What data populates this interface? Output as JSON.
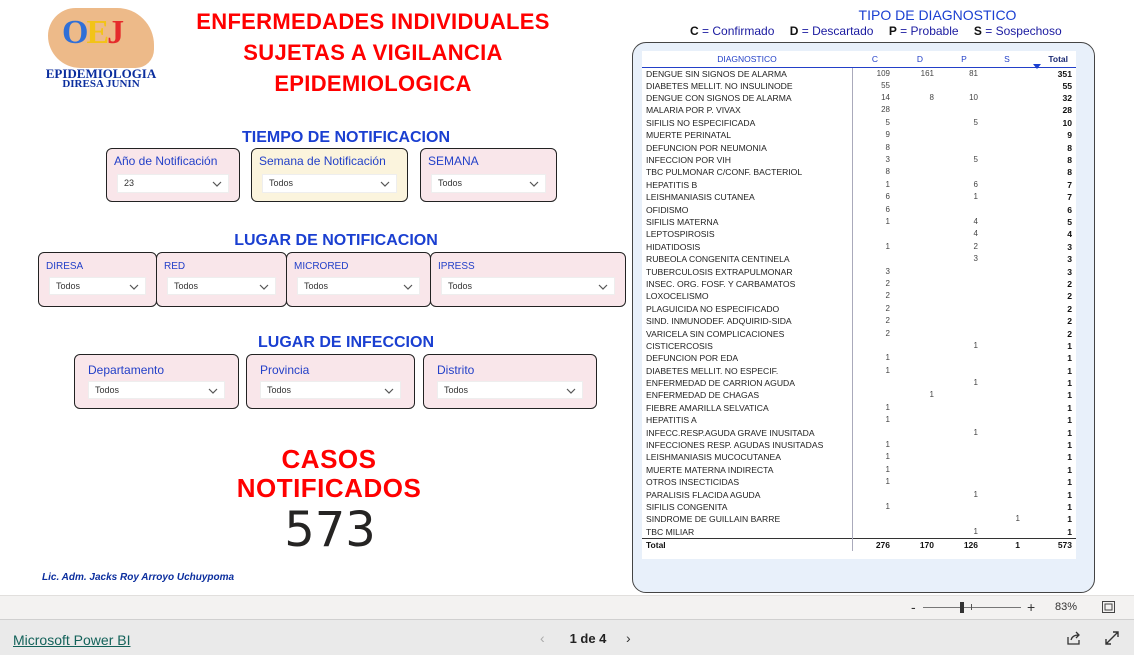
{
  "logo": {
    "letters": [
      "O",
      "E",
      "J"
    ],
    "line1": "EPIDEMIOLOGIA",
    "line2": "DIRESA JUNIN"
  },
  "title": [
    "ENFERMEDADES INDIVIDUALES",
    "SUJETAS A VIGILANCIA",
    "EPIDEMIOLOGICA"
  ],
  "sections": {
    "tiempo": "TIEMPO DE NOTIFICACION",
    "lugar_notif": "LUGAR DE NOTIFICACION",
    "lugar_inf": "LUGAR DE INFECCION"
  },
  "filters": {
    "anio": {
      "label": "Año de Notificación",
      "value": "23"
    },
    "semana_notif": {
      "label": "Semana de Notificación",
      "value": "Todos"
    },
    "semana": {
      "label": "SEMANA",
      "value": "Todos"
    },
    "diresa": {
      "label": "DIRESA",
      "value": "Todos"
    },
    "red": {
      "label": "RED",
      "value": "Todos"
    },
    "microred": {
      "label": "MICRORED",
      "value": "Todos"
    },
    "ipress": {
      "label": "IPRESS",
      "value": "Todos"
    },
    "departamento": {
      "label": "Departamento",
      "value": "Todos"
    },
    "provincia": {
      "label": "Provincia",
      "value": "Todos"
    },
    "distrito": {
      "label": "Distrito",
      "value": "Todos"
    }
  },
  "casos": {
    "title": [
      "CASOS",
      "NOTIFICADOS"
    ],
    "value": "573"
  },
  "author": "Lic. Adm. Jacks Roy Arroyo Uchuypoma",
  "diagnostico_legend": {
    "title": "TIPO DE DIAGNOSTICO",
    "items": [
      {
        "code": "C",
        "text": "= Confirmado"
      },
      {
        "code": "D",
        "text": "= Descartado"
      },
      {
        "code": "P",
        "text": "= Probable"
      },
      {
        "code": "S",
        "text": "= Sospechoso"
      }
    ]
  },
  "table": {
    "headers": [
      "DIAGNOSTICO",
      "C",
      "D",
      "P",
      "S",
      "Total"
    ],
    "rows": [
      [
        "DENGUE SIN SIGNOS DE ALARMA",
        "109",
        "161",
        "81",
        "",
        "351"
      ],
      [
        "DIABETES MELLIT. NO INSULINODE",
        "55",
        "",
        "",
        "",
        "55"
      ],
      [
        "DENGUE CON SIGNOS DE ALARMA",
        "14",
        "8",
        "10",
        "",
        "32"
      ],
      [
        "MALARIA POR P. VIVAX",
        "28",
        "",
        "",
        "",
        "28"
      ],
      [
        "SIFILIS NO ESPECIFICADA",
        "5",
        "",
        "5",
        "",
        "10"
      ],
      [
        "MUERTE PERINATAL",
        "9",
        "",
        "",
        "",
        "9"
      ],
      [
        "DEFUNCION POR NEUMONIA",
        "8",
        "",
        "",
        "",
        "8"
      ],
      [
        "INFECCION POR VIH",
        "3",
        "",
        "5",
        "",
        "8"
      ],
      [
        "TBC PULMONAR C/CONF. BACTERIOL",
        "8",
        "",
        "",
        "",
        "8"
      ],
      [
        "HEPATITIS B",
        "1",
        "",
        "6",
        "",
        "7"
      ],
      [
        "LEISHMANIASIS CUTANEA",
        "6",
        "",
        "1",
        "",
        "7"
      ],
      [
        "OFIDISMO",
        "6",
        "",
        "",
        "",
        "6"
      ],
      [
        "SIFILIS MATERNA",
        "1",
        "",
        "4",
        "",
        "5"
      ],
      [
        "LEPTOSPIROSIS",
        "",
        "",
        "4",
        "",
        "4"
      ],
      [
        "HIDATIDOSIS",
        "1",
        "",
        "2",
        "",
        "3"
      ],
      [
        "RUBEOLA CONGENITA CENTINELA",
        "",
        "",
        "3",
        "",
        "3"
      ],
      [
        "TUBERCULOSIS EXTRAPULMONAR",
        "3",
        "",
        "",
        "",
        "3"
      ],
      [
        "INSEC. ORG. FOSF. Y CARBAMATOS",
        "2",
        "",
        "",
        "",
        "2"
      ],
      [
        "LOXOCELISMO",
        "2",
        "",
        "",
        "",
        "2"
      ],
      [
        "PLAGUICIDA NO ESPECIFICADO",
        "2",
        "",
        "",
        "",
        "2"
      ],
      [
        "SIND. INMUNODEF. ADQUIRID-SIDA",
        "2",
        "",
        "",
        "",
        "2"
      ],
      [
        "VARICELA SIN COMPLICACIONES",
        "2",
        "",
        "",
        "",
        "2"
      ],
      [
        "CISTICERCOSIS",
        "",
        "",
        "1",
        "",
        "1"
      ],
      [
        "DEFUNCION POR EDA",
        "1",
        "",
        "",
        "",
        "1"
      ],
      [
        "DIABETES MELLIT. NO ESPECIF.",
        "1",
        "",
        "",
        "",
        "1"
      ],
      [
        "ENFERMEDAD DE CARRION AGUDA",
        "",
        "",
        "1",
        "",
        "1"
      ],
      [
        "ENFERMEDAD DE CHAGAS",
        "",
        "1",
        "",
        "",
        "1"
      ],
      [
        "FIEBRE AMARILLA SELVATICA",
        "1",
        "",
        "",
        "",
        "1"
      ],
      [
        "HEPATITIS A",
        "1",
        "",
        "",
        "",
        "1"
      ],
      [
        "INFECC.RESP.AGUDA GRAVE INUSITADA",
        "",
        "",
        "1",
        "",
        "1"
      ],
      [
        "INFECCIONES RESP. AGUDAS INUSITADAS",
        "1",
        "",
        "",
        "",
        "1"
      ],
      [
        "LEISHMANIASIS MUCOCUTANEA",
        "1",
        "",
        "",
        "",
        "1"
      ],
      [
        "MUERTE MATERNA INDIRECTA",
        "1",
        "",
        "",
        "",
        "1"
      ],
      [
        "OTROS INSECTICIDAS",
        "1",
        "",
        "",
        "",
        "1"
      ],
      [
        "PARALISIS FLACIDA AGUDA",
        "",
        "",
        "1",
        "",
        "1"
      ],
      [
        "SIFILIS CONGENITA",
        "1",
        "",
        "",
        "",
        "1"
      ],
      [
        "SINDROME DE GUILLAIN BARRE",
        "",
        "",
        "",
        "1",
        "1"
      ],
      [
        "TBC MILIAR",
        "",
        "",
        "1",
        "",
        "1"
      ]
    ],
    "total": [
      "Total",
      "276",
      "170",
      "126",
      "1",
      "573"
    ]
  },
  "zoom": {
    "minus": "-",
    "plus": "+",
    "percent": "83%"
  },
  "footer": {
    "brand": "Microsoft Power BI",
    "page": "1 de 4",
    "prev": "‹",
    "next": "›"
  },
  "colors": {
    "title_red": "#ff0000",
    "section_blue": "#1a3fd1",
    "slicer_pink": "#f9e6ea",
    "slicer_yellow": "#fbf4dd",
    "panel_blue": "#e8f0fa"
  }
}
